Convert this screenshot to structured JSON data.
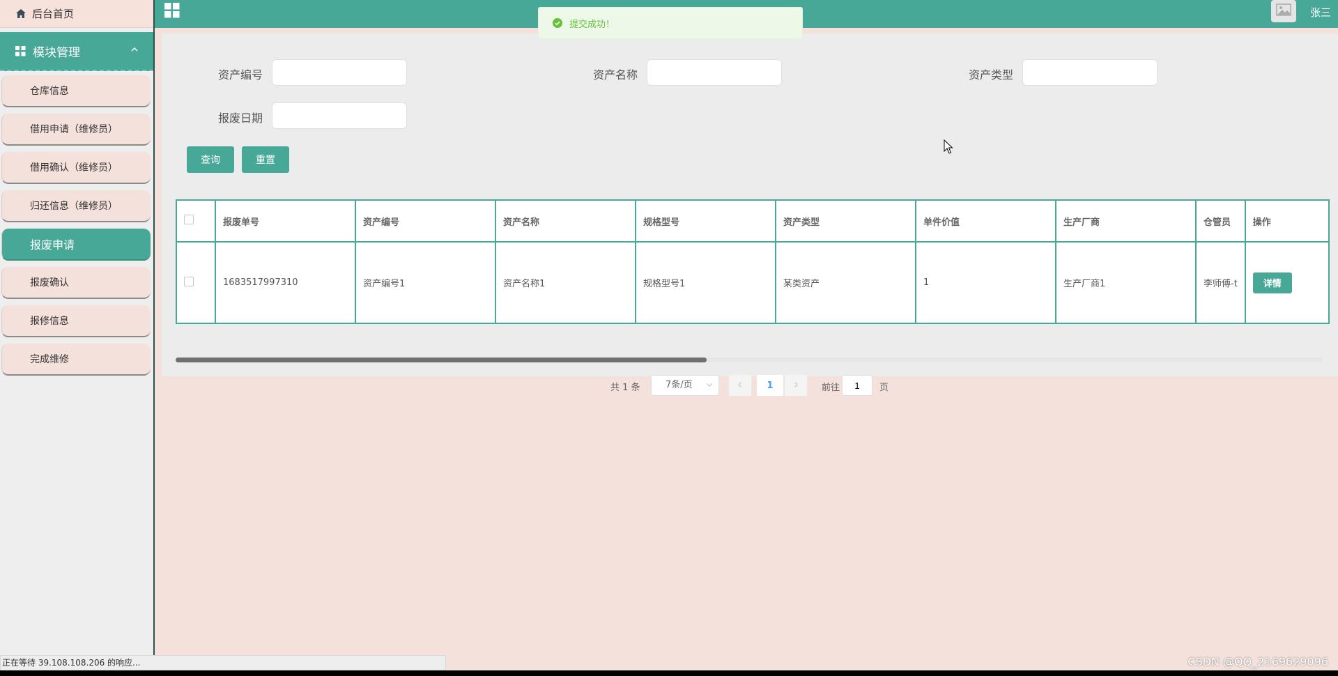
{
  "sidebar": {
    "home_label": "后台首页",
    "module_label": "模块管理",
    "items": [
      {
        "label": "仓库信息"
      },
      {
        "label": "借用申请（维修员）"
      },
      {
        "label": "借用确认（维修员）"
      },
      {
        "label": "归还信息（维修员）"
      },
      {
        "label": "报废申请",
        "active": true
      },
      {
        "label": "报废确认"
      },
      {
        "label": "报修信息"
      },
      {
        "label": "完成维修"
      }
    ]
  },
  "header": {
    "title": "",
    "user_name": "张三",
    "toast_message": "提交成功！"
  },
  "search": {
    "asset_no_label": "资产编号",
    "asset_name_label": "资产名称",
    "asset_type_label": "资产类型",
    "scrap_date_label": "报废日期",
    "query_button": "查询",
    "reset_button": "重置"
  },
  "table": {
    "columns": [
      "报废单号",
      "资产编号",
      "资产名称",
      "规格型号",
      "资产类型",
      "单件价值",
      "生产厂商",
      "仓管员",
      "操作"
    ],
    "rows": [
      {
        "scrap_no": "1683517997310",
        "asset_no": "资产编号1",
        "asset_name": "资产名称1",
        "spec": "规格型号1",
        "asset_type": "某类资产",
        "unit_value": "1",
        "manufacturer": "生产厂商1",
        "keeper": "李师傅-t",
        "action_label": "详情"
      }
    ]
  },
  "pagination": {
    "total_text": "共 1 条",
    "page_size": "7条/页",
    "current_page": "1",
    "goto_label": "前往",
    "goto_value": "1",
    "page_unit": "页"
  },
  "status_bar": {
    "text": "正在等待 39.108.108.206 的响应..."
  },
  "watermark": "CSDN @QQ_2169629096",
  "colors": {
    "accent": "#47a898",
    "sidebar_item_bg": "#f5e1db",
    "success": "#67c23a"
  }
}
